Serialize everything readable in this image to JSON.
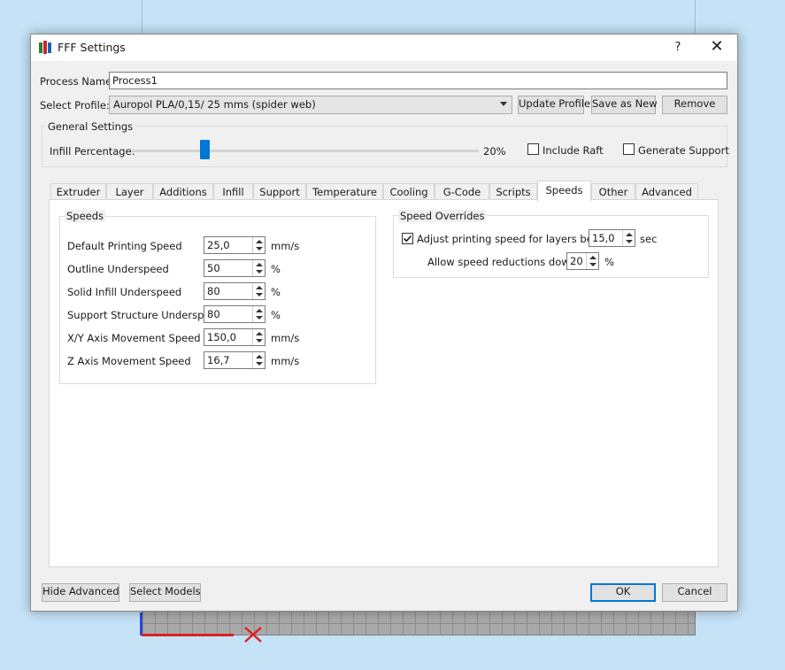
{
  "dialog": {
    "title": "FFF Settings",
    "help_glyph": "?",
    "close_glyph": "✕"
  },
  "process": {
    "name_label": "Process Name:",
    "name_value": "Process1",
    "profile_label": "Select Profile:",
    "profile_value": "Auropol PLA/0,15/ 25 mms (spider web)",
    "update_profile": "Update Profile",
    "save_as_new": "Save as New",
    "remove": "Remove"
  },
  "general": {
    "title": "General Settings",
    "infill_label": "Infill Percentage:",
    "infill_value": "20%",
    "infill_fraction": 0.2,
    "include_raft": "Include Raft",
    "include_raft_checked": false,
    "generate_support": "Generate Support",
    "generate_support_checked": false
  },
  "tabs": [
    {
      "label": "Extruder"
    },
    {
      "label": "Layer"
    },
    {
      "label": "Additions"
    },
    {
      "label": "Infill"
    },
    {
      "label": "Support"
    },
    {
      "label": "Temperature"
    },
    {
      "label": "Cooling"
    },
    {
      "label": "G-Code"
    },
    {
      "label": "Scripts"
    },
    {
      "label": "Speeds",
      "active": true
    },
    {
      "label": "Other"
    },
    {
      "label": "Advanced"
    }
  ],
  "speeds": {
    "title": "Speeds",
    "rows": [
      {
        "label": "Default Printing Speed",
        "value": "25,0",
        "unit": "mm/s"
      },
      {
        "label": "Outline Underspeed",
        "value": "50",
        "unit": "%"
      },
      {
        "label": "Solid Infill Underspeed",
        "value": "80",
        "unit": "%"
      },
      {
        "label": "Support Structure Underspeed",
        "value": "80",
        "unit": "%"
      },
      {
        "label": "X/Y Axis Movement Speed",
        "value": "150,0",
        "unit": "mm/s"
      },
      {
        "label": "Z Axis Movement Speed",
        "value": "16,7",
        "unit": "mm/s"
      }
    ]
  },
  "overrides": {
    "title": "Speed Overrides",
    "adjust_label": "Adjust printing speed for layers below",
    "adjust_checked": true,
    "adjust_value": "15,0",
    "adjust_unit": "sec",
    "allow_label": "Allow speed reductions down to",
    "allow_value": "20",
    "allow_unit": "%"
  },
  "footer": {
    "hide_advanced": "Hide Advanced",
    "select_models": "Select Models",
    "ok": "OK",
    "cancel": "Cancel"
  },
  "colors": {
    "accent": "#0078d7",
    "axis_x": "#e02020",
    "axis_y": "#2a4ad8",
    "viewport_bg": "#c5e2f6"
  }
}
